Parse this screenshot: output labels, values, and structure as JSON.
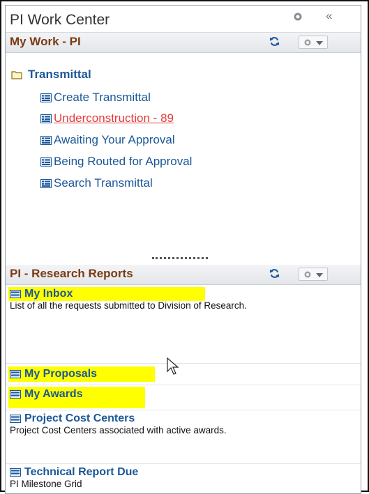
{
  "header": {
    "title": "PI Work Center",
    "collapse_glyph": "«"
  },
  "my_work": {
    "title": "My Work - PI",
    "folder": "Transmittal",
    "links": [
      {
        "label": "Create Transmittal",
        "style": "normal"
      },
      {
        "label": "Underconstruction - 89",
        "style": "alert"
      },
      {
        "label": "Awaiting Your Approval",
        "style": "normal"
      },
      {
        "label": "Being Routed for Approval",
        "style": "normal"
      },
      {
        "label": "Search Transmittal",
        "style": "normal"
      }
    ]
  },
  "reports": {
    "title": "PI - Research Reports",
    "items": [
      {
        "title": "My Inbox",
        "desc": "List of all the requests submitted to Division of Research.",
        "highlighted": true
      },
      {
        "title": "My Proposals",
        "desc": "",
        "highlighted": true
      },
      {
        "title": "My Awards",
        "desc": "",
        "highlighted": true
      },
      {
        "title": "Project Cost Centers",
        "desc": "Project Cost Centers associated with active awards.",
        "highlighted": false
      },
      {
        "title": "Technical Report Due",
        "desc": "PI Milestone Grid",
        "highlighted": false
      }
    ]
  },
  "colors": {
    "link": "#1b5798",
    "pagelet_title": "#7a3b13",
    "alert": "#e23b3b",
    "highlight": "#ffff00"
  },
  "icons": {
    "settings": "gear-icon",
    "collapse": "double-chevron-left-icon",
    "refresh": "refresh-icon",
    "options": "gear-dropdown-icon",
    "folder": "folder-icon",
    "link": "list-icon",
    "cursor": "mouse-pointer-icon"
  }
}
